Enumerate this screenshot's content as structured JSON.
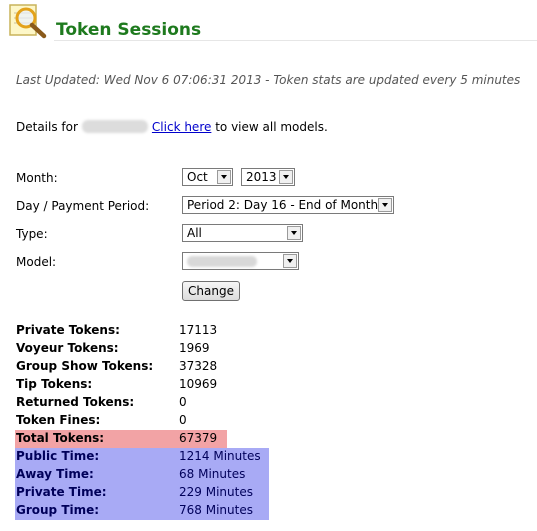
{
  "header": {
    "title": "Token Sessions",
    "icon": "magnifier-notepad-icon"
  },
  "last_updated": "Last Updated: Wed Nov 6 07:06:31 2013 - Token stats are updated every 5 minutes",
  "details": {
    "prefix": "Details for",
    "link_text": "Click here",
    "suffix": "to view all models."
  },
  "form": {
    "month_label": "Month:",
    "month_value": "Oct",
    "year_value": "2013",
    "period_label": "Day / Payment Period:",
    "period_value": "Period 2: Day 16 - End of Month",
    "type_label": "Type:",
    "type_value": "All",
    "model_label": "Model:",
    "button_label": "Change"
  },
  "stats": [
    {
      "label": "Private Tokens:",
      "value": "17113",
      "highlight": "none"
    },
    {
      "label": "Voyeur Tokens:",
      "value": "1969",
      "highlight": "none"
    },
    {
      "label": "Group Show Tokens:",
      "value": "37328",
      "highlight": "none"
    },
    {
      "label": "Tip Tokens:",
      "value": "10969",
      "highlight": "none"
    },
    {
      "label": "Returned Tokens:",
      "value": "0",
      "highlight": "none"
    },
    {
      "label": "Token Fines:",
      "value": "0",
      "highlight": "none"
    },
    {
      "label": "Total Tokens:",
      "value": "67379",
      "highlight": "red"
    },
    {
      "label": "Public Time:",
      "value": "1214 Minutes",
      "highlight": "blue"
    },
    {
      "label": "Away Time:",
      "value": "68 Minutes",
      "highlight": "blue"
    },
    {
      "label": "Private Time:",
      "value": "229 Minutes",
      "highlight": "blue"
    },
    {
      "label": "Group Time:",
      "value": "768 Minutes",
      "highlight": "blue"
    }
  ],
  "colors": {
    "title": "#1e7a1e",
    "total_highlight": "#f2a3a5",
    "time_highlight": "#a8aaf5",
    "link": "#0000cc"
  }
}
